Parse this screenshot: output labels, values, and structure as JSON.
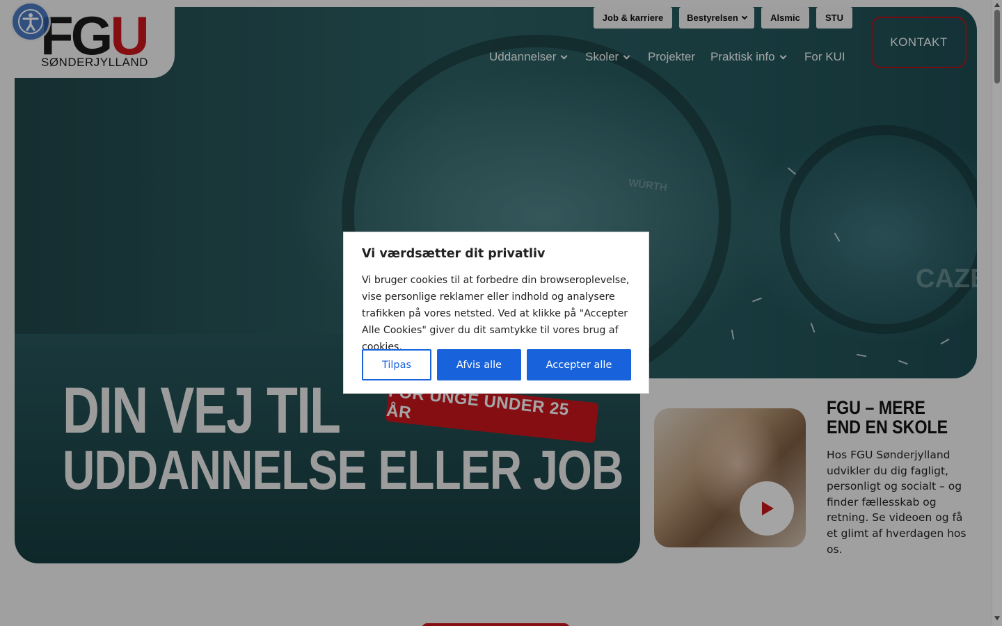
{
  "header": {
    "logo_text_fg": "FG",
    "logo_text_u": "U",
    "logo_subtitle": "SØNDERJYLLAND",
    "utility_links": [
      {
        "label": "Job & karriere",
        "has_dropdown": false
      },
      {
        "label": "Bestyrelsen",
        "has_dropdown": true
      },
      {
        "label": "Alsmic",
        "has_dropdown": false
      },
      {
        "label": "STU",
        "has_dropdown": false
      }
    ],
    "nav": [
      {
        "label": "Uddannelser",
        "has_dropdown": true
      },
      {
        "label": "Skoler",
        "has_dropdown": true
      },
      {
        "label": "Projekter",
        "has_dropdown": false
      },
      {
        "label": "Praktisk info",
        "has_dropdown": true
      },
      {
        "label": "For KUI",
        "has_dropdown": false
      }
    ],
    "contact_label": "KONTAKT"
  },
  "hero": {
    "headline_line1": "DIN VEJ TIL",
    "headline_line2": "UDDANNELSE ELLER JOB",
    "badge": "FOR UNGE UNDER 25 ÅR",
    "machine_text_1": "WÜRTH",
    "machine_text_2": "CAZENI"
  },
  "info": {
    "title": "FGU – MERE END EN SKOLE",
    "text": "Hos FGU Sønderjylland udvikler du dig fagligt, personligt og socialt – og finder fællesskab og retning. Se videoen og få et glimt af hverdagen hos os.",
    "video_icon": "play-icon"
  },
  "cookie_dialog": {
    "title": "Vi værdsætter dit privatliv",
    "text": "Vi bruger cookies til at forbedre din browseroplevelse, vise personlige reklamer eller indhold og analysere trafikken på vores netsted. Ved at klikke på \"Accepter Alle Cookies\" giver du dit samtykke til vores brug af cookies.",
    "customize_label": "Tilpas",
    "reject_label": "Afvis alle",
    "accept_label": "Accepter alle"
  },
  "colors": {
    "brand_red": "#c4161c",
    "cookie_blue": "#1863dc",
    "accessibility_blue": "#2f62b3"
  }
}
